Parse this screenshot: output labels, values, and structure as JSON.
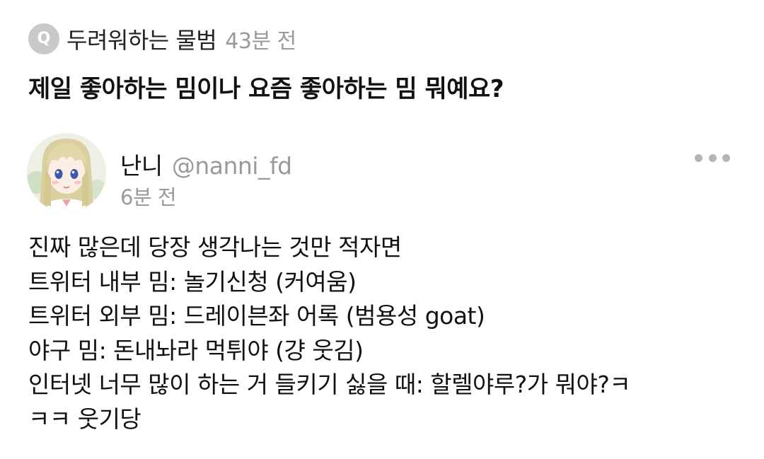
{
  "question": {
    "badge_letter": "Q",
    "asker_name": "두려워하는 물범",
    "asked_time": "43분 전",
    "text": "제일 좋아하는 밈이나 요즘 좋아하는 밈 뭐예요?"
  },
  "answer": {
    "author_name": "난니",
    "author_handle": "@nanni_fd",
    "time": "6분 전",
    "avatar_icon": "anime-girl-avatar",
    "more_icon": "more-options-icon",
    "lines": [
      "진짜 많은데 당장 생각나는 것만 적자면",
      "트위터 내부 밈: 놀기신청 (커여움)",
      "트위터 외부 밈: 드레이븐좌 어록 (범용성 goat)",
      "야구 밈: 돈내놔라 먹튀야 (걍 웃김)",
      "인터넷 너무 많이 하는 거 들키기 싫을 때: 할렐야루?가 뭐야?ㅋ",
      "ㅋㅋ 웃기당"
    ]
  },
  "colors": {
    "badge": "#c9c9c9",
    "muted_text": "#9a9a9a",
    "primary_text": "#111111",
    "more_dots": "#b5b5b5"
  }
}
